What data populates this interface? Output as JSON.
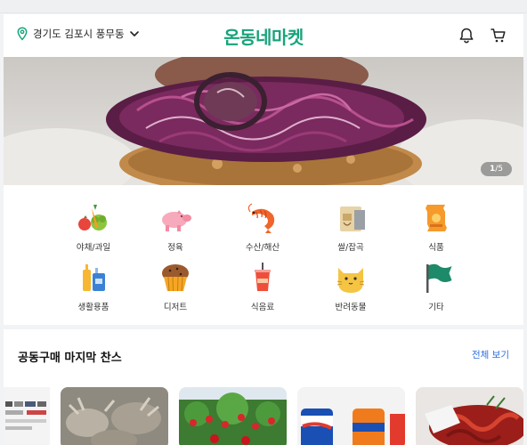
{
  "header": {
    "location": "경기도 김포시 풍무동",
    "logo": "온동네마켓"
  },
  "banner": {
    "current": "1",
    "total": "/5"
  },
  "categories": [
    {
      "label": "야채/과일",
      "icon": "vegetables-icon"
    },
    {
      "label": "정육",
      "icon": "pig-icon"
    },
    {
      "label": "수산/해산",
      "icon": "shrimp-icon"
    },
    {
      "label": "쌀/잡곡",
      "icon": "rice-sack-icon"
    },
    {
      "label": "식품",
      "icon": "snack-bag-icon"
    },
    {
      "label": "생활용품",
      "icon": "household-icon"
    },
    {
      "label": "디저트",
      "icon": "muffin-icon"
    },
    {
      "label": "식음료",
      "icon": "drink-cup-icon"
    },
    {
      "label": "반려동물",
      "icon": "cat-icon"
    },
    {
      "label": "기타",
      "icon": "flag-icon"
    }
  ],
  "group_buy": {
    "title": "공동구매 마지막 찬스",
    "view_all": "전체 보기"
  },
  "colors": {
    "brand": "#17a37a",
    "link": "#2b6de0"
  }
}
